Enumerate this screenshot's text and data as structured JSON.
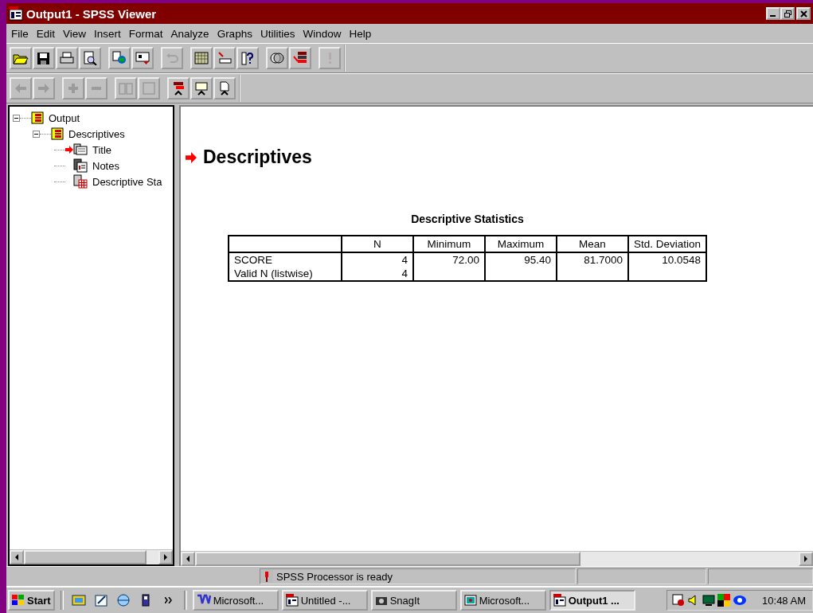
{
  "window": {
    "title": "Output1 - SPSS Viewer"
  },
  "menu": [
    "File",
    "Edit",
    "View",
    "Insert",
    "Format",
    "Analyze",
    "Graphs",
    "Utilities",
    "Window",
    "Help"
  ],
  "toolbar_1": [
    {
      "disabled": false
    },
    {
      "disabled": false
    },
    {
      "disabled": false
    },
    {
      "disabled": false
    },
    {
      "disabled": false
    },
    {
      "disabled": false
    },
    {
      "disabled": true
    },
    {
      "disabled": false
    },
    {
      "disabled": false
    },
    {
      "disabled": false
    },
    {
      "disabled": false
    },
    {
      "disabled": false
    },
    {
      "disabled": true
    }
  ],
  "toolbar_2": [
    {
      "disabled": true
    },
    {
      "disabled": true
    },
    {
      "disabled": true
    },
    {
      "disabled": true
    },
    {
      "disabled": true
    },
    {
      "disabled": true
    },
    {
      "disabled": false
    },
    {
      "disabled": false
    },
    {
      "disabled": false
    }
  ],
  "outline": [
    {
      "label": "Output",
      "expanded": true,
      "children": [
        {
          "label": "Descriptives",
          "expanded": true,
          "children": [
            {
              "label": "Title",
              "kind": "title",
              "current": true
            },
            {
              "label": "Notes",
              "kind": "notes",
              "current": false
            },
            {
              "label": "Descriptive Sta",
              "kind": "table",
              "current": false
            }
          ]
        }
      ]
    }
  ],
  "output": {
    "heading": "Descriptives",
    "table": {
      "title": "Descriptive Statistics",
      "columns": [
        "N",
        "Minimum",
        "Maximum",
        "Mean",
        "Std. Deviation"
      ],
      "rows": [
        {
          "label": "SCORE",
          "cells": [
            "4",
            "72.00",
            "95.40",
            "81.7000",
            "10.0548"
          ]
        },
        {
          "label": "Valid N (listwise)",
          "cells": [
            "4"
          ]
        }
      ]
    }
  },
  "status_bar": {
    "text": "SPSS Processor  is ready"
  },
  "taskbar": {
    "start": "Start",
    "apps": [
      {
        "label": "Microsoft...",
        "kind": "word",
        "selected": false
      },
      {
        "label": "Untitled -...",
        "kind": "spss",
        "selected": false
      },
      {
        "label": "SnagIt",
        "kind": "camera",
        "selected": false
      },
      {
        "label": "Microsoft...",
        "kind": "screen",
        "selected": false
      },
      {
        "label": "Output1 ...",
        "kind": "spss",
        "selected": true
      }
    ],
    "clock": "10:48 AM"
  }
}
